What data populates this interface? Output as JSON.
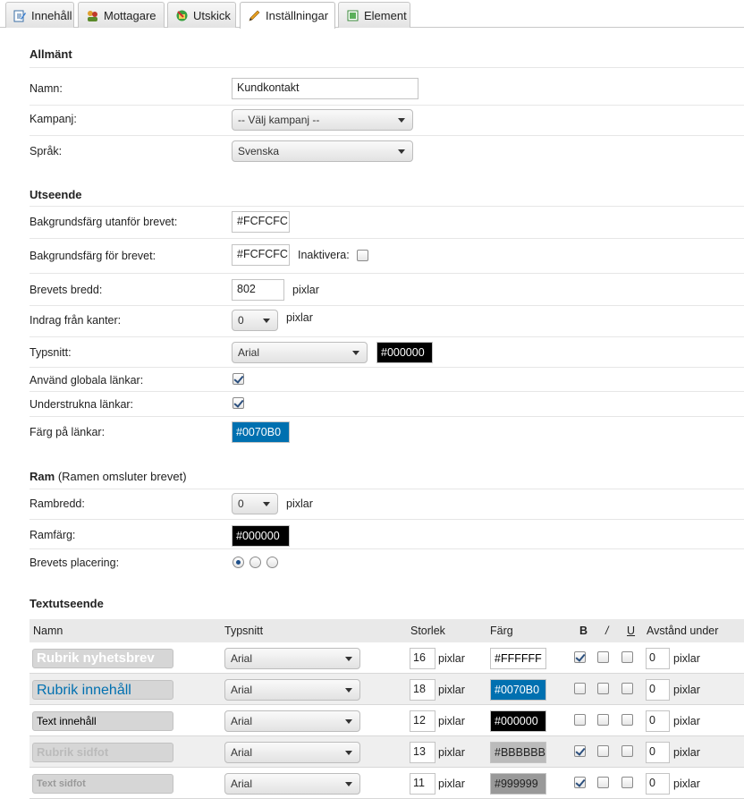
{
  "tabs": [
    {
      "label": "Innehåll",
      "icon": "edit-content-icon"
    },
    {
      "label": "Mottagare",
      "icon": "recipients-icon"
    },
    {
      "label": "Utskick",
      "icon": "dispatch-icon"
    },
    {
      "label": "Inställningar",
      "icon": "pencil-icon"
    },
    {
      "label": "Element",
      "icon": "element-icon"
    }
  ],
  "general": {
    "title": "Allmänt",
    "name_label": "Namn:",
    "name_value": "Kundkontakt",
    "campaign_label": "Kampanj:",
    "campaign_value": "-- Välj kampanj --",
    "language_label": "Språk:",
    "language_value": "Svenska"
  },
  "appearance": {
    "title": "Utseende",
    "bg_outside_label": "Bakgrundsfärg utanför brevet:",
    "bg_outside_value": "#FCFCFC",
    "bg_letter_label": "Bakgrundsfärg för brevet:",
    "bg_letter_value": "#FCFCFC",
    "disable_label": "Inaktivera:",
    "disable_checked": false,
    "width_label": "Brevets bredd:",
    "width_value": "802",
    "width_unit": "pixlar",
    "indent_label": "Indrag från kanter:",
    "indent_value": "0",
    "indent_unit": "pixlar",
    "font_label": "Typsnitt:",
    "font_value": "Arial",
    "font_color": "#000000",
    "global_links_label": "Använd globala länkar:",
    "global_links_checked": true,
    "underline_links_label": "Understrukna länkar:",
    "underline_links_checked": true,
    "link_color_label": "Färg på länkar:",
    "link_color": "#0070B0"
  },
  "frame": {
    "title": "Ram",
    "subtitle": "(Ramen omsluter brevet)",
    "width_label": "Rambredd:",
    "width_value": "0",
    "width_unit": "pixlar",
    "color_label": "Ramfärg:",
    "color_value": "#000000",
    "placement_label": "Brevets placering:",
    "placement_selected": 0
  },
  "text_appearance": {
    "title": "Textutseende",
    "headers": {
      "name": "Namn",
      "font": "Typsnitt",
      "size": "Storlek",
      "color": "Färg",
      "bold": "B",
      "italic": "/",
      "underline": "U",
      "spacing": "Avstånd under"
    },
    "rows": [
      {
        "name": "Rubrik nyhetsbrev",
        "font": "Arial",
        "size": "16",
        "unit": "pixlar",
        "color": "#FFFFFF",
        "bold": true,
        "italic": false,
        "underline": false,
        "spacing": "0",
        "spacing_unit": "pixlar"
      },
      {
        "name": "Rubrik innehåll",
        "font": "Arial",
        "size": "18",
        "unit": "pixlar",
        "color": "#0070B0",
        "bold": false,
        "italic": false,
        "underline": false,
        "spacing": "0",
        "spacing_unit": "pixlar"
      },
      {
        "name": "Text innehåll",
        "font": "Arial",
        "size": "12",
        "unit": "pixlar",
        "color": "#000000",
        "bold": false,
        "italic": false,
        "underline": false,
        "spacing": "0",
        "spacing_unit": "pixlar"
      },
      {
        "name": "Rubrik sidfot",
        "font": "Arial",
        "size": "13",
        "unit": "pixlar",
        "color": "#BBBBBB",
        "bold": true,
        "italic": false,
        "underline": false,
        "spacing": "0",
        "spacing_unit": "pixlar"
      },
      {
        "name": "Text sidfot",
        "font": "Arial",
        "size": "11",
        "unit": "pixlar",
        "color": "#999999",
        "bold": true,
        "italic": false,
        "underline": false,
        "spacing": "0",
        "spacing_unit": "pixlar"
      }
    ]
  }
}
